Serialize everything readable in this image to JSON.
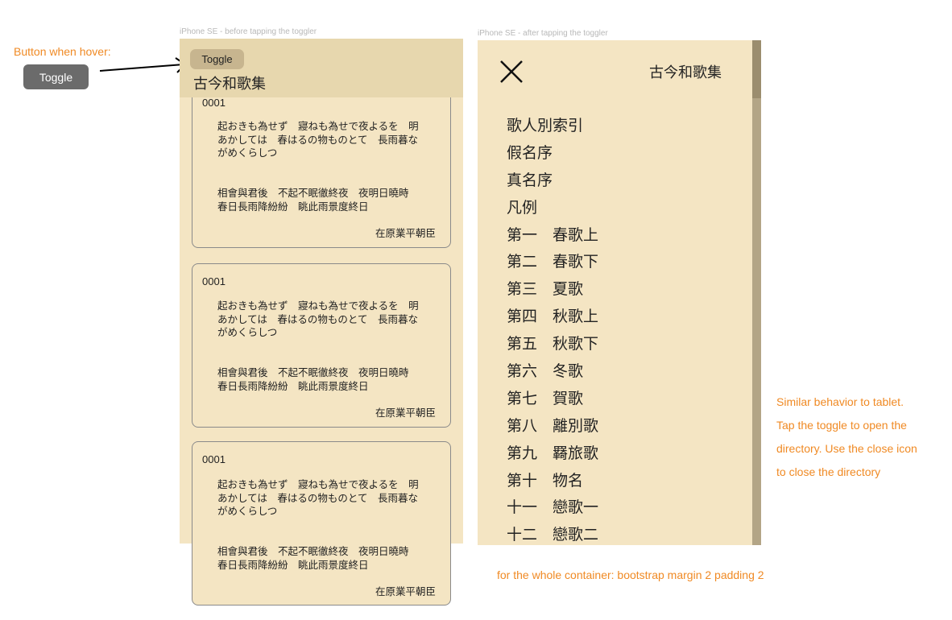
{
  "labels": {
    "before": "iPhone SE - before tapping the toggler",
    "after": "iPhone SE - after tapping the toggler"
  },
  "annotations": {
    "hover_title": "Button when hover:",
    "hover_button": "Toggle",
    "note_lines": [
      "Similar behavior to tablet.",
      "Tap the toggle to open the",
      "directory. Use the close icon",
      "to close the directory"
    ],
    "container_note": "for the whole container: bootstrap margin 2 padding 2"
  },
  "left_phone": {
    "toggle_label": "Toggle",
    "brand": "古今和歌集",
    "cards": [
      {
        "number": "0001",
        "kana": "起おきも為せず　寢ねも為せで夜よるを　明\nあかしては　春はるの物ものとて　長雨暮な\nがめくらしつ",
        "kanbun": "相會與君後　不起不眠徹終夜　夜明日曉時\n春日長雨降紛紛　眺此雨景度終日",
        "author": "在原業平朝臣"
      },
      {
        "number": "0001",
        "kana": "起おきも為せず　寢ねも為せで夜よるを　明\nあかしては　春はるの物ものとて　長雨暮な\nがめくらしつ",
        "kanbun": "相會與君後　不起不眠徹終夜　夜明日曉時\n春日長雨降紛紛　眺此雨景度終日",
        "author": "在原業平朝臣"
      },
      {
        "number": "0001",
        "kana": "起おきも為せず　寢ねも為せで夜よるを　明\nあかしては　春はるの物ものとて　長雨暮な\nがめくらしつ",
        "kanbun": "相會與君後　不起不眠徹終夜　夜明日曉時\n春日長雨降紛紛　眺此雨景度終日",
        "author": "在原業平朝臣"
      }
    ]
  },
  "right_phone": {
    "close_icon": "close-icon",
    "brand": "古今和歌集",
    "directory": [
      "歌人別索引",
      "假名序",
      "真名序",
      "凡例",
      "第一　春歌上",
      "第二　春歌下",
      "第三　夏歌",
      "第四　秋歌上",
      "第五　秋歌下",
      "第六　冬歌",
      "第七　賀歌",
      "第八　離別歌",
      "第九　羇旅歌",
      "第十　物名",
      "十一　戀歌一",
      "十二　戀歌二"
    ]
  },
  "colors": {
    "page_bg": "#f4e5c3",
    "navbar_bg": "#e7d7ae",
    "toggle_bg": "#c7b58f",
    "hover_bg": "#6b6b6b",
    "annotation": "#f08a24",
    "scrollbar": "#b3a586"
  }
}
